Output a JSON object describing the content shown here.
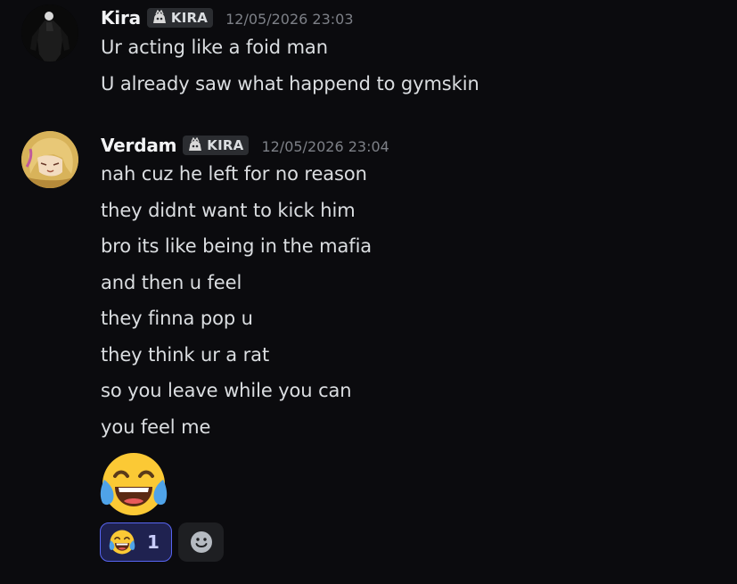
{
  "messages": [
    {
      "author": "Kira",
      "tag": "KIRA",
      "timestamp": "12/05/2026 23:03",
      "lines": [
        "Ur acting like a foid man",
        "U already saw what happend to gymskin"
      ]
    },
    {
      "author": "Verdam",
      "tag": "KIRA",
      "timestamp": "12/05/2026 23:04",
      "lines": [
        "nah cuz he left for no reason",
        "they didnt want to kick him",
        "bro its like being in the mafia",
        "and then u feel",
        "they finna pop u",
        "they think ur a rat",
        "so you leave while you can",
        "you feel me"
      ],
      "emoji": "joy-emoji"
    }
  ],
  "reactions": [
    {
      "emoji": "joy-emoji",
      "count": "1",
      "active": true
    }
  ],
  "add_reaction_icon": "smiley-add-reaction-icon",
  "colors": {
    "background": "#0b0b0e",
    "text": "#dbdee1",
    "timestamp": "#7d8087",
    "reaction_active_bg": "#1f2250",
    "reaction_active_border": "#5865f2"
  }
}
